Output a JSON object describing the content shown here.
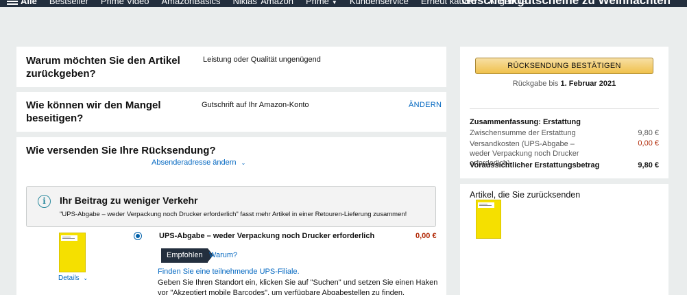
{
  "nav": {
    "all_label": "Alle",
    "items": [
      "Bestseller",
      "Prime Video",
      "AmazonBasics",
      "Niklas' Amazon",
      "Prime",
      "Kundenservice",
      "Erneut kaufen",
      "Angebote"
    ],
    "promo": "Geschenkgutscheine zu Weihnachten"
  },
  "reason": {
    "question": "Warum möchten Sie den Artikel zurückgeben?",
    "answer": "Leistung oder Qualität ungenügend"
  },
  "resolution": {
    "question": "Wie können wir den Mangel beseitigen?",
    "answer": "Gutschrift auf Ihr Amazon-Konto",
    "change_label": "ÄNDERN"
  },
  "shipping": {
    "question": "Wie versenden Sie Ihre Rücksendung?",
    "change_sender_label": "Absenderadresse ändern",
    "info_title": "Ihr Beitrag zu weniger Verkehr",
    "info_text": "\"UPS-Abgabe – weder Verpackung noch Drucker erforderlich\" fasst mehr Artikel in einer Retouren-Lieferung zusammen!",
    "details_label": "Details",
    "option": {
      "label": "UPS-Abgabe – weder Verpackung noch Drucker erforderlich",
      "price": "0,00 €",
      "selected": true,
      "badge": "Empfohlen",
      "why_label": "Warum?",
      "find_link": "Finden Sie eine teilnehmende UPS-Filiale.",
      "description": "Geben Sie Ihren Standort ein, klicken Sie auf \"Suchen\" und setzen Sie einen Haken vor \"Akzeptiert mobile Barcodes\", um verfügbare Abgabestellen zu finden."
    }
  },
  "sidebar": {
    "confirm_button": "RÜCKSENDUNG BESTÄTIGEN",
    "deadline_prefix": "Rückgabe bis",
    "deadline_date": "1. Februar 2021",
    "summary_title": "Zusammenfassung: Erstattung",
    "subtotal_label": "Zwischensumme der Erstattung",
    "subtotal_amount": "9,80 €",
    "shipping_label": "Versandkosten (UPS-Abgabe – weder Verpackung noch Drucker erforderlich)",
    "shipping_amount": "0,00 €",
    "total_label": "Voraussichtlicher Erstattungsbetrag",
    "total_amount": "9,80 €",
    "items_title": "Artikel, die Sie zurücksenden"
  },
  "colors": {
    "nav_bg": "#232f3e",
    "link": "#0066c0",
    "price_red": "#b12704",
    "button_yellow": "#f0c14b",
    "book_yellow": "#f5e000"
  }
}
